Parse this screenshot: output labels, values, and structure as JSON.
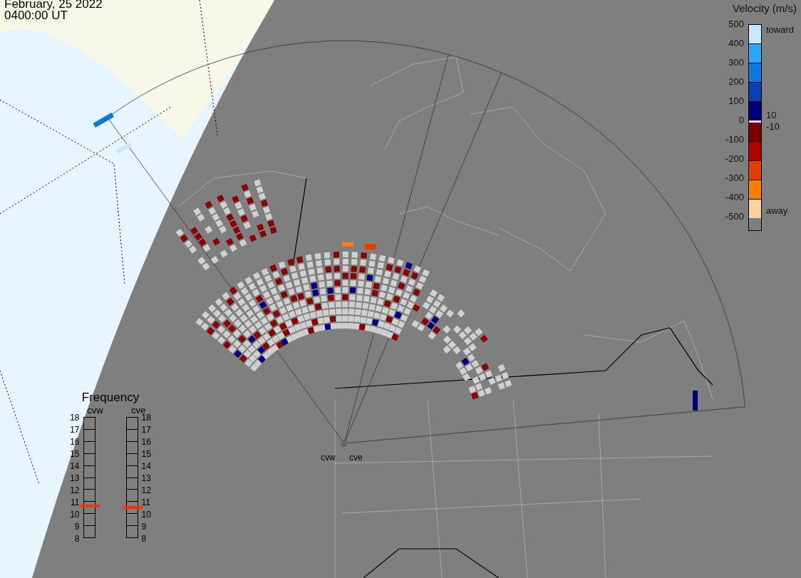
{
  "header": {
    "date": "February, 25 2022",
    "time": "0400:00 UT"
  },
  "velocity_scale": {
    "title": "Velocity (m/s)",
    "ticks": [
      "500",
      "400",
      "300",
      "200",
      "100",
      "0",
      "-100",
      "-200",
      "-300",
      "-400",
      "-500"
    ],
    "toward": "toward",
    "away": "away",
    "near_positive": "10",
    "near_negative": "-10",
    "segments": [
      {
        "color": "#c8e8ff"
      },
      {
        "color": "#2aa8ff"
      },
      {
        "color": "#0a78e0"
      },
      {
        "color": "#0a40b0"
      },
      {
        "color": "#00007a"
      },
      {
        "color": "#7a0000"
      },
      {
        "color": "#b00000"
      },
      {
        "color": "#e04000"
      },
      {
        "color": "#ff8000"
      },
      {
        "color": "#ffd0a0"
      }
    ]
  },
  "frequency": {
    "title": "Frequency",
    "left_ticks": [
      "18",
      "17",
      "16",
      "15",
      "14",
      "13",
      "12",
      "11",
      "10",
      "9",
      "8"
    ],
    "right_ticks": [
      "18",
      "17",
      "16",
      "15",
      "14",
      "13",
      "12",
      "11",
      "10",
      "9",
      "8"
    ],
    "radars": [
      {
        "name": "cvw",
        "level": 0.26
      },
      {
        "name": "cve",
        "level": 0.25
      }
    ]
  },
  "radar_sites": [
    "cvw",
    "cve"
  ]
}
